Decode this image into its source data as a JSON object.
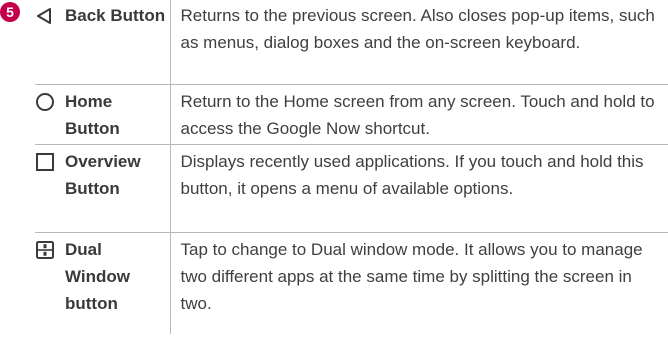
{
  "step_number": "5",
  "keys": [
    {
      "icon": "back-triangle-icon",
      "label": "Back Button",
      "description": "Returns to the previous screen. Also closes pop-up items, such as menus, dialog boxes and the on-screen keyboard."
    },
    {
      "icon": "home-circle-icon",
      "label": "Home Button",
      "description": "Return to the Home screen from any screen. Touch and hold to access the Google Now shortcut."
    },
    {
      "icon": "overview-square-icon",
      "label": "Overview Button",
      "description": "Displays recently used applications. If you touch and hold this button, it opens a menu of available options."
    },
    {
      "icon": "dual-window-icon",
      "label": "Dual Window button",
      "description": "Tap to change to Dual window mode. It allows you to manage two different apps at the same time by splitting the screen in two."
    }
  ],
  "colors": {
    "badge": "#c5004a",
    "text": "#3a3a3a",
    "border": "#b8b8b8"
  }
}
